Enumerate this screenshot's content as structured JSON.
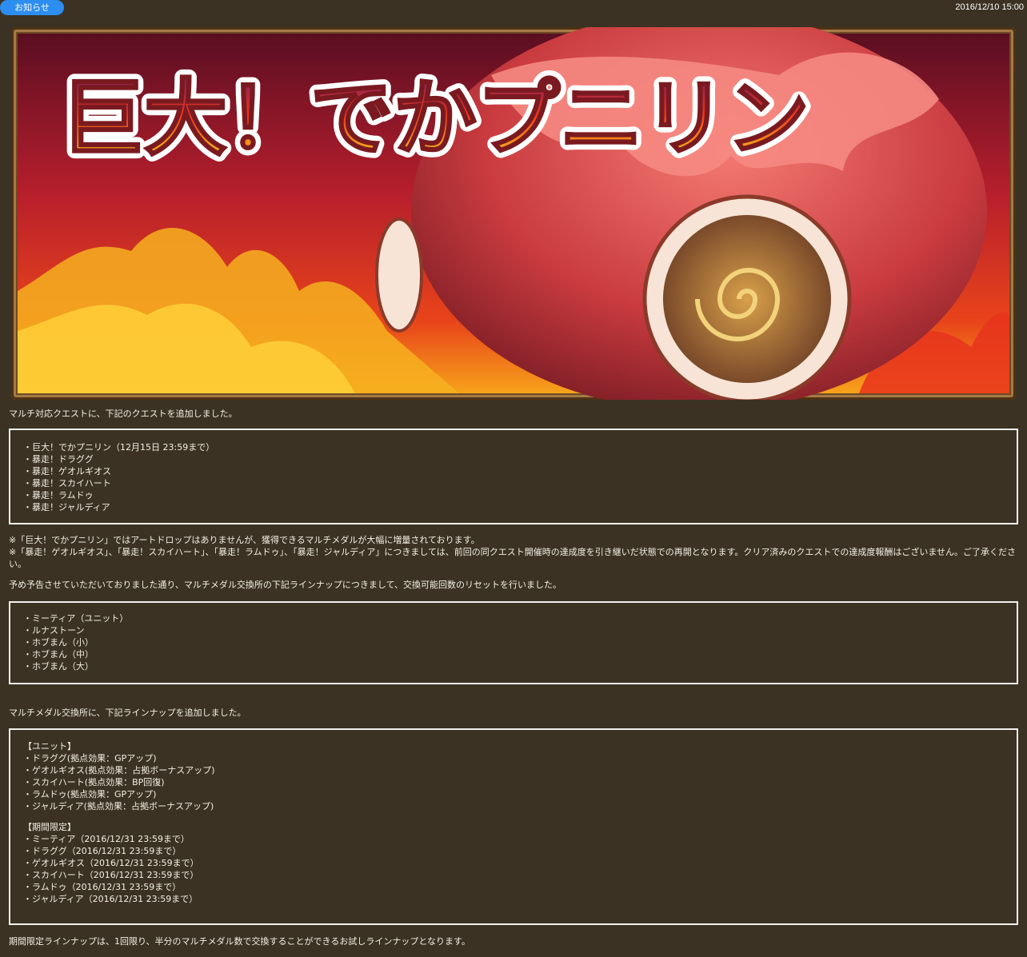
{
  "header": {
    "category": "お知らせ",
    "date": "2016/12/10 15:00"
  },
  "banner": {
    "title": "巨大！でかプニリン"
  },
  "intro": "マルチ対応クエストに、下記のクエストを追加しました。",
  "quests": [
    "・巨大！でかプニリン（12月15日 23:59まで）",
    "・暴走！ドラググ",
    "・暴走！ゲオルギオス",
    "・暴走！スカイハート",
    "・暴走！ラムドゥ",
    "・暴走！ジャルディア"
  ],
  "notes": [
    "※「巨大！でかプニリン」ではアートドロップはありませんが、獲得できるマルチメダルが大幅に増量されております。",
    "※「暴走！ゲオルギオス」、「暴走！スカイハート」、「暴走！ラムドゥ」、「暴走！ジャルディア」につきましては、前回の同クエスト開催時の達成度を引き継いだ状態での再開となります。クリア済みのクエストでの達成度報酬はございません。ご了承ください。"
  ],
  "reset_text": "予め予告させていただいておりました通り、マルチメダル交換所の下記ラインナップにつきまして、交換可能回数のリセットを行いました。",
  "reset_items": [
    "・ミーティア（ユニット）",
    "・ルナストーン",
    "・ホブまん（小）",
    "・ホブまん（中）",
    "・ホブまん（大）"
  ],
  "lineup_text": "マルチメダル交換所に、下記ラインナップを追加しました。",
  "lineup": {
    "unit_heading": "【ユニット】",
    "units": [
      "・ドラググ(拠点効果：GPアップ)",
      "・ゲオルギオス(拠点効果：占拠ボーナスアップ)",
      "・スカイハート(拠点効果：BP回復)",
      "・ラムドゥ(拠点効果：GPアップ)",
      "・ジャルディア(拠点効果：占拠ボーナスアップ)"
    ],
    "limited_heading": "【期間限定】",
    "limited": [
      "・ミーティア（2016/12/31 23:59まで）",
      "・ドラググ（2016/12/31 23:59まで）",
      "・ゲオルギオス（2016/12/31 23:59まで）",
      "・スカイハート（2016/12/31 23:59まで）",
      "・ラムドゥ（2016/12/31 23:59まで）",
      "・ジャルディア（2016/12/31 23:59まで）"
    ]
  },
  "footer_text": "期間限定ラインナップは、1回限り、半分のマルチメダル数で交換することができるお試しラインナップとなります。",
  "colors": {
    "background": "#3b3223",
    "badge": "#2c8ef0",
    "text": "#f3efe4",
    "box_border": "#f2f2f2"
  }
}
